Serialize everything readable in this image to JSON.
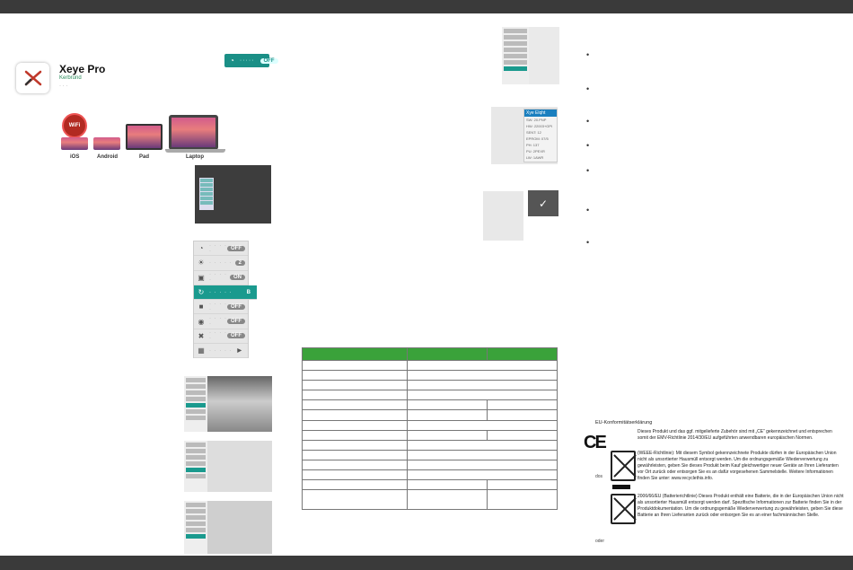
{
  "app": {
    "title": "Xeye Pro",
    "subtitle": "Kerbrund",
    "dots": "· · ·"
  },
  "wifi_badge": {
    "value": "OFF"
  },
  "devices": {
    "wifi_label": "WiFi",
    "ios": "iOS",
    "android": "Android",
    "pad": "Pad",
    "laptop": "Laptop"
  },
  "settings_menu": {
    "rows": [
      {
        "icon": "wifi-icon",
        "glyph": "◔",
        "dots": "· · · · ·",
        "value": "OFF"
      },
      {
        "icon": "brightness-icon",
        "glyph": "☀",
        "dots": "· · · · ·",
        "value": "2"
      },
      {
        "icon": "camera-icon",
        "glyph": "▣",
        "dots": "· · · · ·",
        "value": "ON"
      },
      {
        "icon": "rotate-icon",
        "glyph": "↻",
        "dots": "· · · · ·",
        "value": "B"
      },
      {
        "icon": "frame-icon",
        "glyph": "■",
        "dots": "· · · · ·",
        "value": "OFF"
      },
      {
        "icon": "target-icon",
        "glyph": "◉",
        "dots": "· · · · ·",
        "value": "OFF"
      },
      {
        "icon": "fan-icon",
        "glyph": "✖",
        "dots": "· · · · ·",
        "value": "OFF"
      },
      {
        "icon": "grid-icon",
        "glyph": "▦",
        "dots": "· · · · ·",
        "value": "▶"
      }
    ]
  },
  "info_box": {
    "header": "Xye Elqht",
    "lines": [
      "SW: 20.PNP",
      "HW: 22003+GPI",
      "SENT: 12",
      "EPROM: 07/5",
      "PH: 137",
      "PU: 2PEXR",
      "LW: 1AWR"
    ]
  },
  "bullets": [
    "•",
    "•",
    "•",
    "•",
    "•",
    "•",
    "•"
  ],
  "eu": {
    "title": "EU-Konformitätserklärung",
    "ce_mark": "CE",
    "para1": "Dieses Produkt und das ggf. mitgelieferte Zubehör sind mit „CE“ gekennzeichnet und entsprechen somit der EMV-Richtlinie 2014/30/EU aufgeführten anwendbaren europäischen Normen.",
    "para2": "(WEEE-Richtlinie): Mit diesem Symbol gekennzeichnete Produkte dürfen in der Europäischen Union nicht als unsortierter Hausmüll entsorgt werden. Um die ordnungsgemäße Wiederverwertung zu gewährleisten, geben Sie dieses Produkt beim Kauf gleichwertiger neuer Geräte an Ihren Lieferanten vor Ort zurück oder entsorgen Sie es an dafür vorgesehenen Sammelstelle. Weitere Informationen finden Sie unter: www.recyclethis.info.",
    "para3": "2006/66/EU (Batterierichtlinie) Dieses Produkt enthält eine Batterie, die in der Europäischen Union nicht als unsortierter Hausmüll entsorgt werden darf. Spezifische Informationen zur Batterie finden Sie in der Produktdokumentation. Um die ordnungsgemäße Wiederverwertung zu gewährleisten, geben Sie diese Batterie an Ihren Lieferanten zurück oder entsorgen Sie es an einer fachmännischen Stelle.",
    "side1": "dos",
    "side2": "oder"
  }
}
